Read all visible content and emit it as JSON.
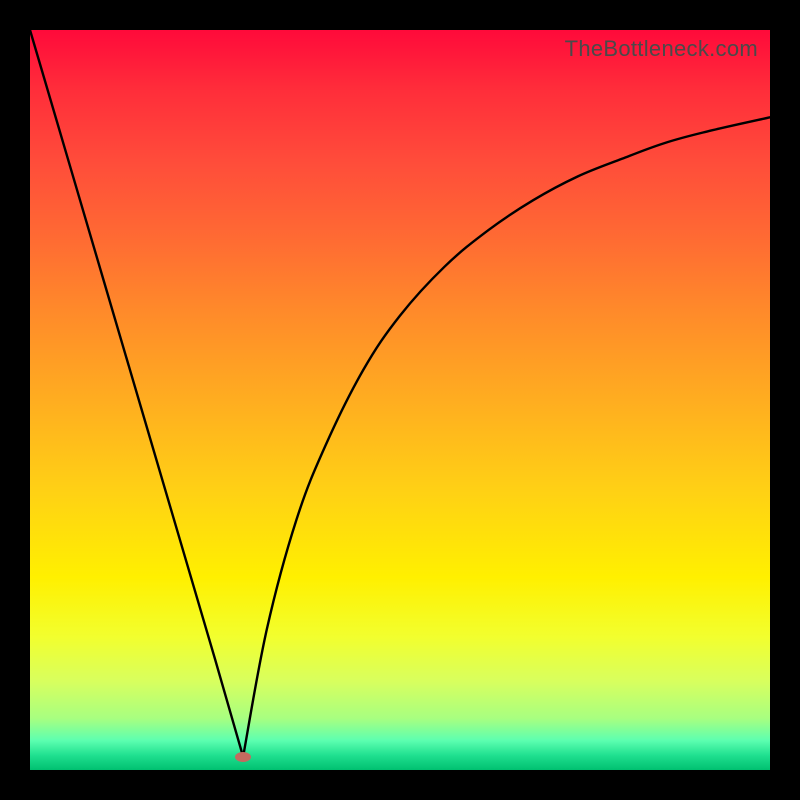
{
  "watermark": "TheBottleneck.com",
  "chart_data": {
    "type": "line",
    "title": "",
    "xlabel": "",
    "ylabel": "",
    "xlim": [
      0,
      1
    ],
    "ylim": [
      0,
      1
    ],
    "legend": false,
    "grid": false,
    "series": [
      {
        "name": "left-branch",
        "x": [
          0.0,
          0.05,
          0.1,
          0.15,
          0.2,
          0.25,
          0.288
        ],
        "y": [
          1.0,
          0.83,
          0.66,
          0.49,
          0.32,
          0.15,
          0.018
        ]
      },
      {
        "name": "right-branch",
        "x": [
          0.288,
          0.32,
          0.36,
          0.4,
          0.45,
          0.5,
          0.56,
          0.62,
          0.68,
          0.74,
          0.8,
          0.86,
          0.92,
          1.0
        ],
        "y": [
          0.018,
          0.19,
          0.338,
          0.44,
          0.54,
          0.614,
          0.68,
          0.73,
          0.77,
          0.802,
          0.826,
          0.848,
          0.864,
          0.882
        ]
      }
    ],
    "marker": {
      "x": 0.288,
      "y": 0.018,
      "color": "#c46a5f"
    },
    "gradient_stops": [
      {
        "pos": 0.0,
        "color": "#ff0a3a"
      },
      {
        "pos": 0.5,
        "color": "#ffad20"
      },
      {
        "pos": 0.74,
        "color": "#fff000"
      },
      {
        "pos": 1.0,
        "color": "#00c070"
      }
    ]
  }
}
